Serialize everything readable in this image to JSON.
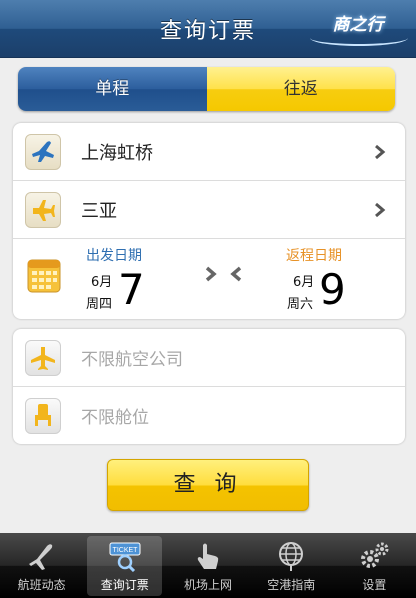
{
  "header": {
    "title": "查询订票",
    "logo_text": "商之行"
  },
  "trip_type": {
    "one_way": "单程",
    "round_trip": "往返",
    "selected": "one_way"
  },
  "route": {
    "from": "上海虹桥",
    "to": "三亚"
  },
  "dates": {
    "depart": {
      "label": "出发日期",
      "month": "6月",
      "weekday": "周四",
      "day": "7"
    },
    "return": {
      "label": "返程日期",
      "month": "6月",
      "weekday": "周六",
      "day": "9"
    }
  },
  "filters": {
    "airline_placeholder": "不限航空公司",
    "cabin_placeholder": "不限舱位"
  },
  "query_button": "查 询",
  "tabbar": {
    "items": [
      {
        "label": "航班动态",
        "icon": "airplane-icon"
      },
      {
        "label": "查询订票",
        "icon": "ticket-search-icon"
      },
      {
        "label": "机场上网",
        "icon": "touch-hand-icon"
      },
      {
        "label": "空港指南",
        "icon": "globe-icon"
      },
      {
        "label": "设置",
        "icon": "gears-icon"
      }
    ],
    "active_index": 1,
    "ticket_badge_text": "TICKET"
  },
  "colors": {
    "header": "#2f5f92",
    "accent_yellow": "#ffdd3d",
    "blue_label": "#2f6fb1",
    "orange_label": "#e79227"
  }
}
